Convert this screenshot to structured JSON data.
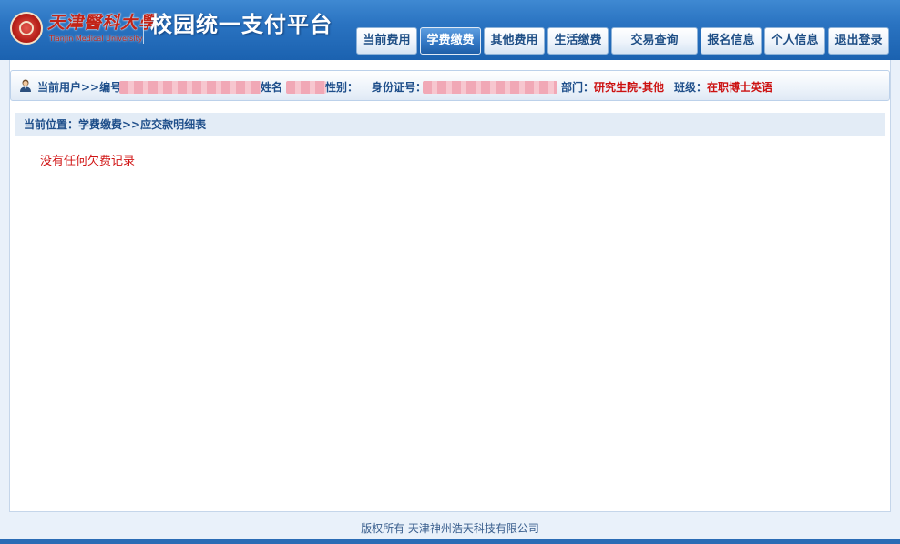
{
  "header": {
    "school_name_cn": "天津醫科大學",
    "school_name_en": "Tianjin Medical University",
    "platform_title": "校园统一支付平台",
    "logo_icon": "university-seal-icon"
  },
  "nav": {
    "items": [
      {
        "label": "当前费用",
        "active": false
      },
      {
        "label": "学费缴费",
        "active": true
      },
      {
        "label": "其他费用",
        "active": false
      },
      {
        "label": "生活缴费",
        "active": false
      },
      {
        "label": "交易查询",
        "active": false
      },
      {
        "label": "报名信息",
        "active": false
      },
      {
        "label": "个人信息",
        "active": false
      },
      {
        "label": "退出登录",
        "active": false
      }
    ]
  },
  "userbar": {
    "icon": "user-icon",
    "current_user": "当前用户>>编号",
    "name_label": "姓名",
    "gender_label": "性别：",
    "id_label": "身份证号：",
    "dept_label": "部门：",
    "dept_value": "研究生院-其他",
    "class_label": "班级：",
    "class_value": "在职博士英语"
  },
  "breadcrumb": "当前位置：学费缴费>>应交款明细表",
  "message": "没有任何欠费记录",
  "footer": "版权所有 天津神州浩天科技有限公司",
  "colors": {
    "header_blue": "#2a73c1",
    "active_tab": "#3478c5",
    "label_blue": "#1e4e8a",
    "alert_red": "#cc1111"
  }
}
